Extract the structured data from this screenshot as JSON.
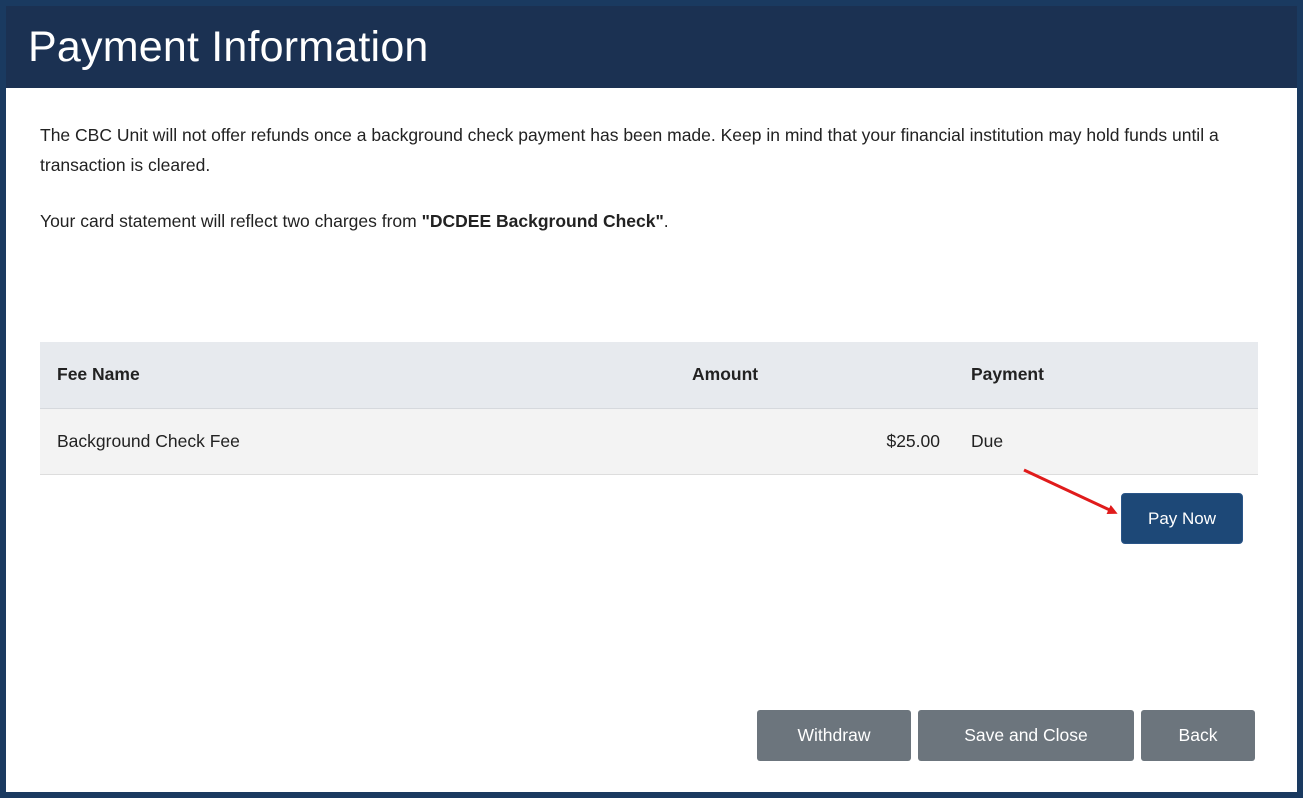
{
  "page": {
    "title": "Payment Information"
  },
  "notice": {
    "refund_text": "The CBC Unit will not offer refunds once a background check payment has been made. Keep in mind that your financial institution may hold funds until a transaction is cleared.",
    "statement_prefix": "Your card statement will reflect two charges from ",
    "statement_merchant": "\"DCDEE Background Check\"",
    "statement_suffix": "."
  },
  "fee_table": {
    "headers": {
      "fee_name": "Fee Name",
      "amount": "Amount",
      "payment": "Payment"
    },
    "rows": [
      {
        "fee_name": "Background Check Fee",
        "amount": "$25.00",
        "payment": "Due"
      }
    ]
  },
  "actions": {
    "pay_now_label": "Pay Now",
    "withdraw_label": "Withdraw",
    "save_close_label": "Save and Close",
    "back_label": "Back"
  },
  "annotation": {
    "arrow_color": "#e01b1b",
    "target": "pay-now-button"
  },
  "colors": {
    "header_bg": "#1b3152",
    "primary_button": "#1d4877",
    "secondary_button": "#6c757d",
    "table_header_bg": "#e7eaee"
  }
}
